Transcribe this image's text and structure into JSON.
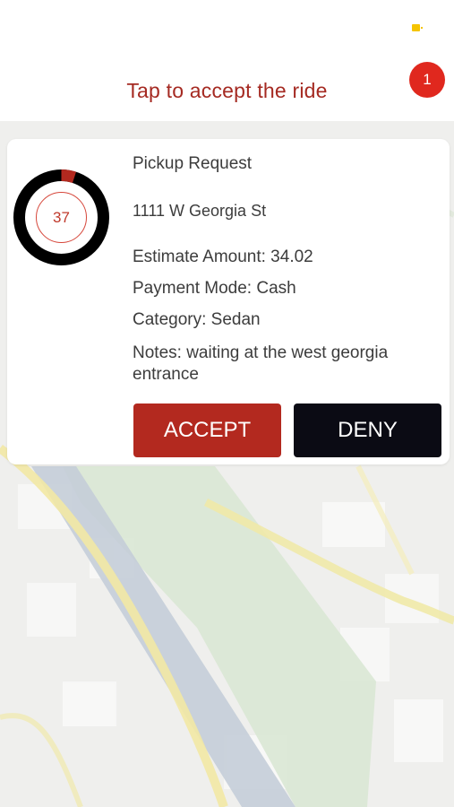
{
  "header": {
    "title": "Tap to accept the ride",
    "badge_count": "1",
    "status_icon": "battery-icon"
  },
  "request": {
    "timer_seconds": "37",
    "timer_progress": 0.05,
    "title": "Pickup Request",
    "address": "1111 W Georgia St",
    "estimate": "Estimate Amount: 34.02",
    "payment": "Payment Mode: Cash",
    "category": "Category: Sedan",
    "notes": "Notes: waiting at the west georgia entrance"
  },
  "actions": {
    "accept_label": "ACCEPT",
    "deny_label": "DENY"
  },
  "colors": {
    "accent_red": "#b3291f",
    "badge_red": "#e0281e",
    "deny_dark": "#0b0b14"
  }
}
